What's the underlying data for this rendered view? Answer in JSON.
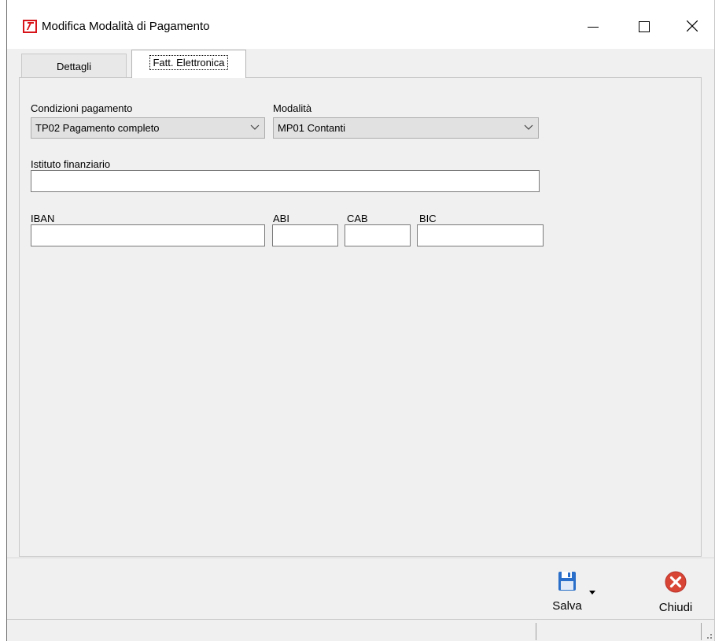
{
  "window": {
    "title": "Modifica Modalità di Pagamento",
    "icon": "app-seven-icon"
  },
  "tabs": [
    {
      "label": "Dettagli",
      "active": false
    },
    {
      "label": "Fatt. Elettronica",
      "active": true
    }
  ],
  "form": {
    "condizioni_label": "Condizioni pagamento",
    "condizioni_value": "TP02 Pagamento completo",
    "modalita_label": "Modalità",
    "modalita_value": "MP01 Contanti",
    "istituto_label": "Istituto finanziario",
    "istituto_value": "",
    "iban_label": "IBAN",
    "iban_value": "",
    "abi_label": "ABI",
    "abi_value": "",
    "cab_label": "CAB",
    "cab_value": "",
    "bic_label": "BIC",
    "bic_value": ""
  },
  "toolbar": {
    "save_label": "Salva",
    "close_label": "Chiudi"
  },
  "colors": {
    "save_icon": "#2a6fc9",
    "close_icon": "#d94535",
    "app_icon": "#d7141a"
  }
}
